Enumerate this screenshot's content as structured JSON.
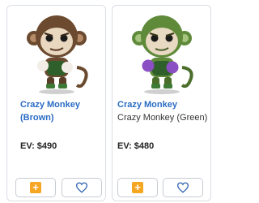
{
  "cards": [
    {
      "title": "Crazy Monkey (Brown)",
      "subtitle": "",
      "ev": "EV: $490",
      "figure": "funko-pop-crazy-monkey-brown",
      "add_icon": "plus-icon",
      "fav_icon": "heart-outline-icon"
    },
    {
      "title": "Crazy Monkey",
      "subtitle": "Crazy Monkey (Green)",
      "ev": "EV: $480",
      "figure": "funko-pop-crazy-monkey-green",
      "add_icon": "plus-icon",
      "fav_icon": "heart-outline-icon"
    }
  ],
  "colors": {
    "link": "#2b6cc4",
    "add_accent": "#f5a623",
    "heart": "#2b5fb0",
    "border": "#d9dde3"
  }
}
